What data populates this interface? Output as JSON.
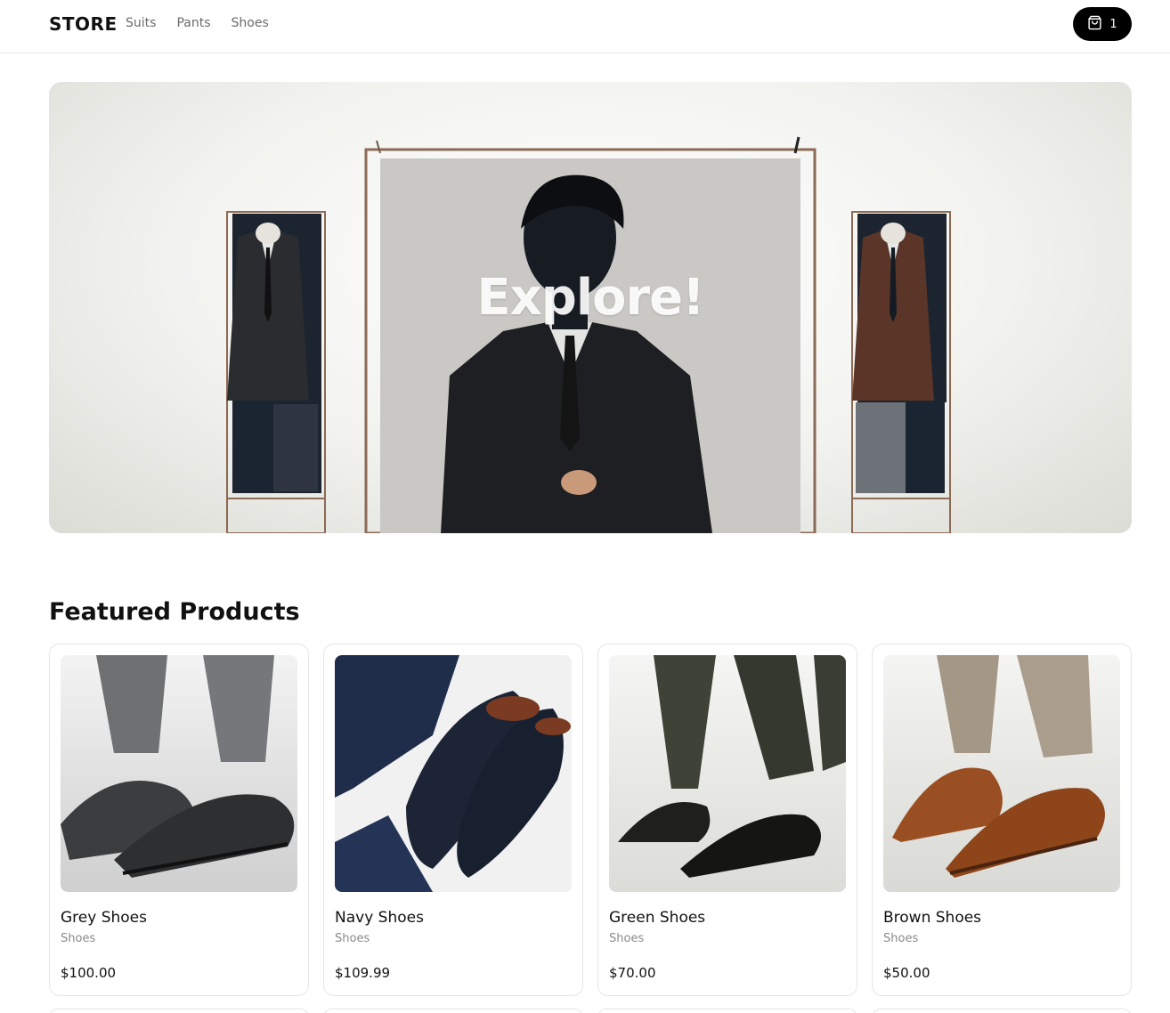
{
  "header": {
    "brand": "STORE",
    "nav": [
      "Suits",
      "Pants",
      "Shoes"
    ],
    "cart_count": "1",
    "cart_icon": "shopping-bag-icon"
  },
  "hero": {
    "title": "Explore!"
  },
  "featured": {
    "title": "Featured Products",
    "products": [
      {
        "name": "Grey Shoes",
        "category": "Shoes",
        "price": "$100.00",
        "shoe_color": "#3c3d3f",
        "pant_color": "#6f7072"
      },
      {
        "name": "Navy Shoes",
        "category": "Shoes",
        "price": "$109.99",
        "shoe_color": "#1c2436",
        "pant_color": "#1f2d4a"
      },
      {
        "name": "Green Shoes",
        "category": "Shoes",
        "price": "$70.00",
        "shoe_color": "#1f1f1c",
        "pant_color": "#3f4236"
      },
      {
        "name": "Brown Shoes",
        "category": "Shoes",
        "price": "$50.00",
        "shoe_color": "#9a4f22",
        "pant_color": "#a59786"
      }
    ]
  },
  "colors": {
    "accent": "#000000",
    "muted_text": "#6b6b6b",
    "border": "#e5e5e5"
  }
}
